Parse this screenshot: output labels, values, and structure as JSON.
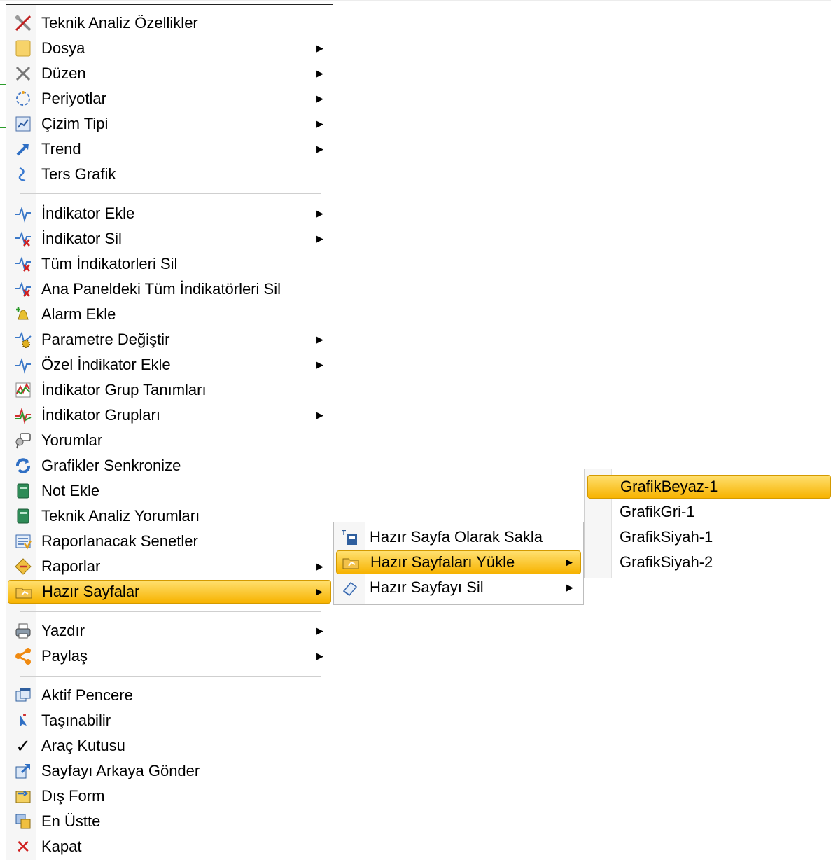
{
  "main_menu": {
    "items": [
      {
        "label": "Teknik Analiz Özellikler",
        "icon": "tools-icon",
        "submenu": false
      },
      {
        "label": "Dosya",
        "icon": "folder-icon",
        "submenu": true
      },
      {
        "label": "Düzen",
        "icon": "wrench-hammer-icon",
        "submenu": true
      },
      {
        "label": "Periyotlar",
        "icon": "periods-icon",
        "submenu": true
      },
      {
        "label": "Çizim Tipi",
        "icon": "chart-type-icon",
        "submenu": true
      },
      {
        "label": "Trend",
        "icon": "trend-arrow-icon",
        "submenu": true
      },
      {
        "label": "Ters Grafik",
        "icon": "reverse-chart-icon",
        "submenu": false
      },
      {
        "label": "İndikator Ekle",
        "icon": "indicator-add-icon",
        "submenu": true
      },
      {
        "label": "İndikator Sil",
        "icon": "indicator-remove-icon",
        "submenu": true
      },
      {
        "label": "Tüm İndikatorleri Sil",
        "icon": "indicator-remove-all-icon",
        "submenu": false
      },
      {
        "label": "Ana Paneldeki Tüm İndikatörleri Sil",
        "icon": "indicator-remove-panel-icon",
        "submenu": false
      },
      {
        "label": "Alarm Ekle",
        "icon": "alarm-bell-icon",
        "submenu": false
      },
      {
        "label": "Parametre Değiştir",
        "icon": "parameter-gear-icon",
        "submenu": true
      },
      {
        "label": "Özel İndikator Ekle",
        "icon": "custom-indicator-icon",
        "submenu": true
      },
      {
        "label": "İndikator Grup Tanımları",
        "icon": "indicator-group-def-icon",
        "submenu": false
      },
      {
        "label": "İndikator Grupları",
        "icon": "indicator-groups-icon",
        "submenu": true
      },
      {
        "label": "Yorumlar",
        "icon": "comments-icon",
        "submenu": false
      },
      {
        "label": "Grafikler Senkronize",
        "icon": "sync-icon",
        "submenu": false
      },
      {
        "label": "Not Ekle",
        "icon": "note-book-icon",
        "submenu": false
      },
      {
        "label": "Teknik Analiz Yorumları",
        "icon": "analysis-notes-icon",
        "submenu": false
      },
      {
        "label": "Raporlanacak Senetler",
        "icon": "report-list-icon",
        "submenu": false
      },
      {
        "label": "Raporlar",
        "icon": "reports-icon",
        "submenu": true
      },
      {
        "label": "Hazır Sayfalar",
        "icon": "ready-pages-folder-icon",
        "submenu": true,
        "highlighted": true
      },
      {
        "label": "Yazdır",
        "icon": "printer-icon",
        "submenu": true
      },
      {
        "label": "Paylaş",
        "icon": "share-icon",
        "submenu": true
      },
      {
        "label": "Aktif Pencere",
        "icon": "active-window-icon",
        "submenu": false
      },
      {
        "label": "Taşınabilir",
        "icon": "movable-cursor-icon",
        "submenu": false
      },
      {
        "label": "Araç Kutusu",
        "icon": "checkmark-icon",
        "submenu": false
      },
      {
        "label": "Sayfayı Arkaya Gönder",
        "icon": "send-back-icon",
        "submenu": false
      },
      {
        "label": "Dış Form",
        "icon": "external-form-icon",
        "submenu": false
      },
      {
        "label": "En Üstte",
        "icon": "bring-front-icon",
        "submenu": false
      },
      {
        "label": "Kapat",
        "icon": "close-x-icon",
        "submenu": false
      }
    ]
  },
  "sub_menu": {
    "items": [
      {
        "label": "Hazır Sayfa Olarak Sakla",
        "icon": "save-disk-icon",
        "submenu": false
      },
      {
        "label": "Hazır Sayfaları Yükle",
        "icon": "load-folder-icon",
        "submenu": true,
        "highlighted": true
      },
      {
        "label": "Hazır Sayfayı Sil",
        "icon": "eraser-icon",
        "submenu": true
      }
    ]
  },
  "subsub_menu": {
    "items": [
      {
        "label": "GrafikBeyaz-1",
        "highlighted": true
      },
      {
        "label": "GrafikGri-1"
      },
      {
        "label": "GrafikSiyah-1"
      },
      {
        "label": "GrafikSiyah-2"
      }
    ]
  },
  "colors": {
    "highlight_top": "#ffe070",
    "highlight_bottom": "#f7b300",
    "separator": "#cfcfcf"
  },
  "glyphs": {
    "submenu_arrow": "▶",
    "check": "✓",
    "close": "✕"
  }
}
